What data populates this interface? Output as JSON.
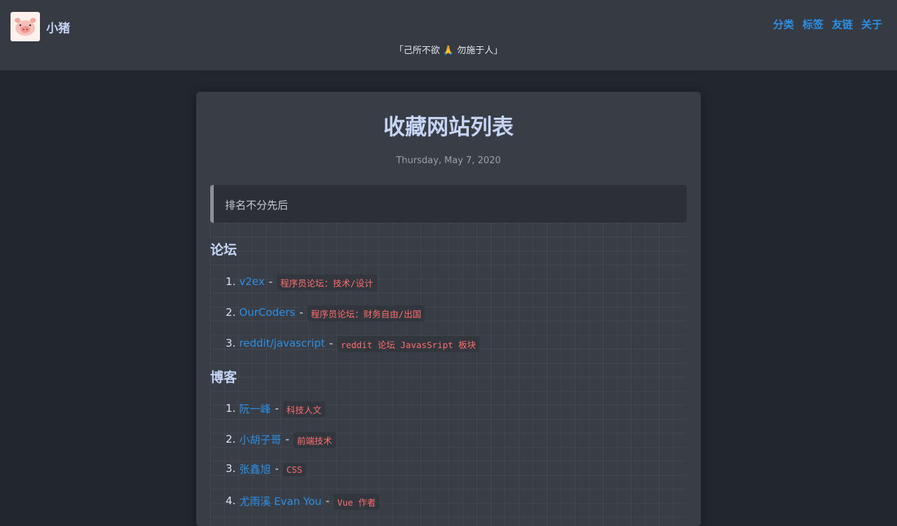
{
  "site": {
    "name": "小猪",
    "tagline": "「己所不欲 🙏 勿施于人」"
  },
  "nav": {
    "items": [
      "分类",
      "标签",
      "友链",
      "关于"
    ]
  },
  "post": {
    "title": "收藏网站列表",
    "date": "Thursday, May 7, 2020",
    "notice": "排名不分先后"
  },
  "sections": [
    {
      "title": "论坛",
      "items": [
        {
          "num": "1.",
          "name": "v2ex",
          "sep": "-",
          "desc": "程序员论坛：技术/设计"
        },
        {
          "num": "2.",
          "name": "OurCoders",
          "sep": "-",
          "desc": "程序员论坛：财务自由/出国"
        },
        {
          "num": "3.",
          "name": "reddit/javascript",
          "sep": "-",
          "desc": "reddit 论坛 JavasSript 板块"
        }
      ]
    },
    {
      "title": "博客",
      "items": [
        {
          "num": "1.",
          "name": "阮一峰",
          "sep": "-",
          "desc": "科技人文"
        },
        {
          "num": "2.",
          "name": "小胡子哥",
          "sep": "-",
          "desc": "前端技术"
        },
        {
          "num": "3.",
          "name": "张鑫旭",
          "sep": "-",
          "desc": "CSS"
        },
        {
          "num": "4.",
          "name": "尤雨溪 Evan You",
          "sep": "-",
          "desc": "Vue 作者"
        }
      ]
    }
  ],
  "colors": {
    "accent": "#2b8fe6",
    "code": "#ff6d6d",
    "heading": "#c6d5f5"
  },
  "icons": {
    "logo": "pig-logo-icon"
  }
}
